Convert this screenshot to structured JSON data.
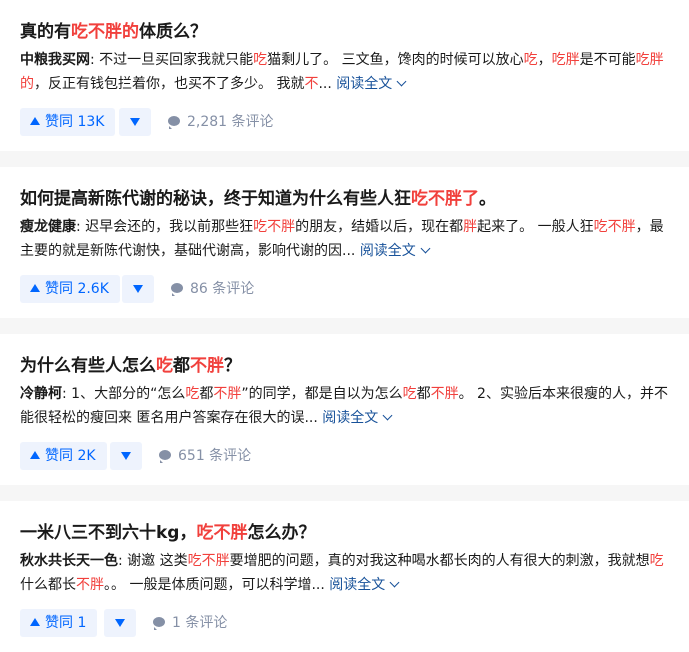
{
  "colors": {
    "highlight": "#f1403c",
    "link": "#175199",
    "accent": "#0066ff",
    "meta": "#8590a6"
  },
  "read_more_label": "阅读全文",
  "cards": [
    {
      "title": [
        "真的有",
        "吃不胖的",
        "体质么？"
      ],
      "author": "中粮我买网",
      "excerpt": [
        ": 不过一旦买回家我就只能",
        "吃",
        "猫剩儿了。 三文鱼，馋肉的时候可以放心",
        "吃",
        "，",
        "吃胖",
        "是不可能",
        "吃胖的",
        "，反正有钱包拦着你，也买不了多少。 我就",
        "不",
        "..."
      ],
      "votes": "赞同 13K",
      "comments": "2,281 条评论"
    },
    {
      "title": [
        "如何提高新陈代谢的秘诀，终于知道为什么有些人狂",
        "吃不胖了",
        "。"
      ],
      "author": "瘦龙健康",
      "excerpt": [
        ": 迟早会还的，我以前那些狂",
        "吃不胖",
        "的朋友，结婚以后，现在都",
        "胖",
        "起来了。 一般人狂",
        "吃不胖",
        "，最主要的就是新陈代谢快，基础代谢高，影响代谢的因..."
      ],
      "votes": "赞同 2.6K",
      "comments": "86 条评论"
    },
    {
      "title": [
        "为什么有些人怎么",
        "吃",
        "都",
        "不胖",
        "？"
      ],
      "author": "冷静柯",
      "excerpt": [
        ": 1、大部分的“怎么",
        "吃",
        "都",
        "不胖",
        "”的同学，都是自以为怎么",
        "吃",
        "都",
        "不胖",
        "。 2、实验后本来很瘦的人，并不能很轻松的瘦回来 匿名用户答案存在很大的误..."
      ],
      "votes": "赞同 2K",
      "comments": "651 条评论"
    },
    {
      "title": [
        "一米八三不到六十kg，",
        "吃不胖",
        "怎么办？"
      ],
      "author": "秋水共长天一色",
      "excerpt": [
        ": 谢邀 这类",
        "吃不胖",
        "要增肥的问题，真的对我这种喝水都长肉的人有很大的刺激，我就想",
        "吃",
        "什么都长",
        "不胖",
        "。。 一般是体质问题，可以科学增..."
      ],
      "votes": "赞同 1",
      "comments": "1 条评论"
    }
  ]
}
